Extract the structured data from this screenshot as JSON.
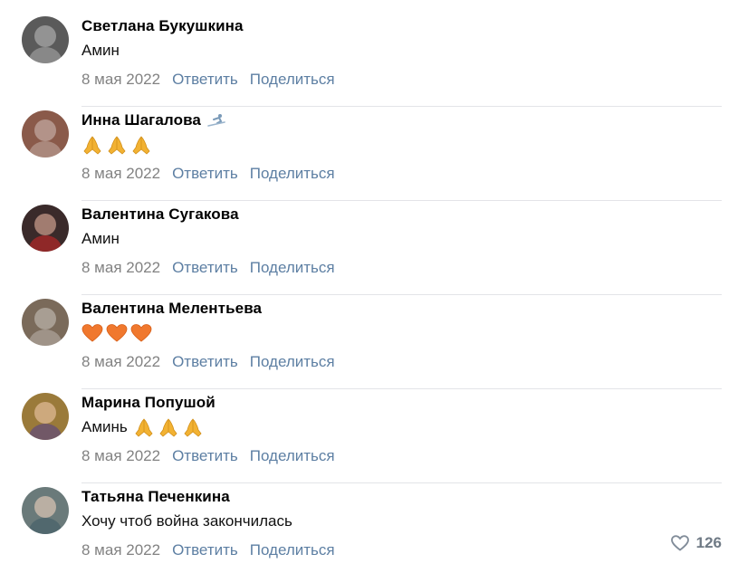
{
  "comments": [
    {
      "author": "Светлана Букушкина",
      "text": "Амин",
      "emoji": [],
      "date": "8 мая 2022",
      "reply_label": "Ответить",
      "share_label": "Поделиться",
      "avatar_color": "#5a5a5a",
      "badge": null
    },
    {
      "author": "Инна Шагалова",
      "text": "",
      "emoji": [
        "folded-hands-icon",
        "folded-hands-icon",
        "folded-hands-icon"
      ],
      "date": "8 мая 2022",
      "reply_label": "Ответить",
      "share_label": "Поделиться",
      "avatar_color": "#8a5a4a",
      "badge": "skier-icon"
    },
    {
      "author": "Валентина Сугакова",
      "text": "Амин",
      "emoji": [],
      "date": "8 мая 2022",
      "reply_label": "Ответить",
      "share_label": "Поделиться",
      "avatar_color": "#3a2a2a",
      "badge": null
    },
    {
      "author": "Валентина Мелентьева",
      "text": "",
      "emoji": [
        "orange-heart-icon",
        "orange-heart-icon",
        "orange-heart-icon"
      ],
      "date": "8 мая 2022",
      "reply_label": "Ответить",
      "share_label": "Поделиться",
      "avatar_color": "#7a6a5a",
      "badge": null
    },
    {
      "author": "Марина Попушой",
      "text": "Аминь",
      "emoji": [
        "folded-hands-icon",
        "folded-hands-icon",
        "folded-hands-icon"
      ],
      "date": "8 мая 2022",
      "reply_label": "Ответить",
      "share_label": "Поделиться",
      "avatar_color": "#9a7a3a",
      "badge": null
    },
    {
      "author": "Татьяна Печенкина",
      "text": "Хочу чтоб война закончилась",
      "emoji": [],
      "date": "8 мая 2022",
      "reply_label": "Ответить",
      "share_label": "Поделиться",
      "avatar_color": "#6a7a7a",
      "badge": null,
      "likes": "126"
    }
  ],
  "colors": {
    "link": "#5d7fa3",
    "date": "#828282",
    "divider": "#e3e4e8",
    "folded_hands": "#f2b233",
    "heart": "#f0782e"
  }
}
